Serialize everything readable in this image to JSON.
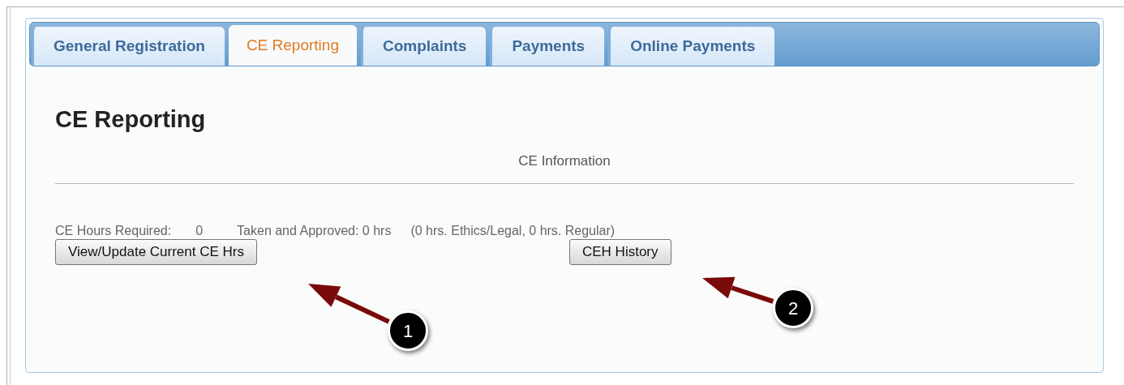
{
  "tabs": [
    {
      "label": "General Registration",
      "selected": false
    },
    {
      "label": "CE Reporting",
      "selected": true
    },
    {
      "label": "Complaints",
      "selected": false
    },
    {
      "label": "Payments",
      "selected": false
    },
    {
      "label": "Online Payments",
      "selected": false
    }
  ],
  "heading": "CE Reporting",
  "section_title": "CE Information",
  "summary": {
    "required_label": "CE Hours Required:",
    "required_value": "0",
    "taken": "Taken and Approved: 0 hrs",
    "breakdown": "(0 hrs. Ethics/Legal, 0 hrs. Regular)"
  },
  "buttons": [
    "View/Update Current CE Hrs",
    "CEH History"
  ],
  "callouts": [
    {
      "number": "1"
    },
    {
      "number": "2"
    }
  ]
}
